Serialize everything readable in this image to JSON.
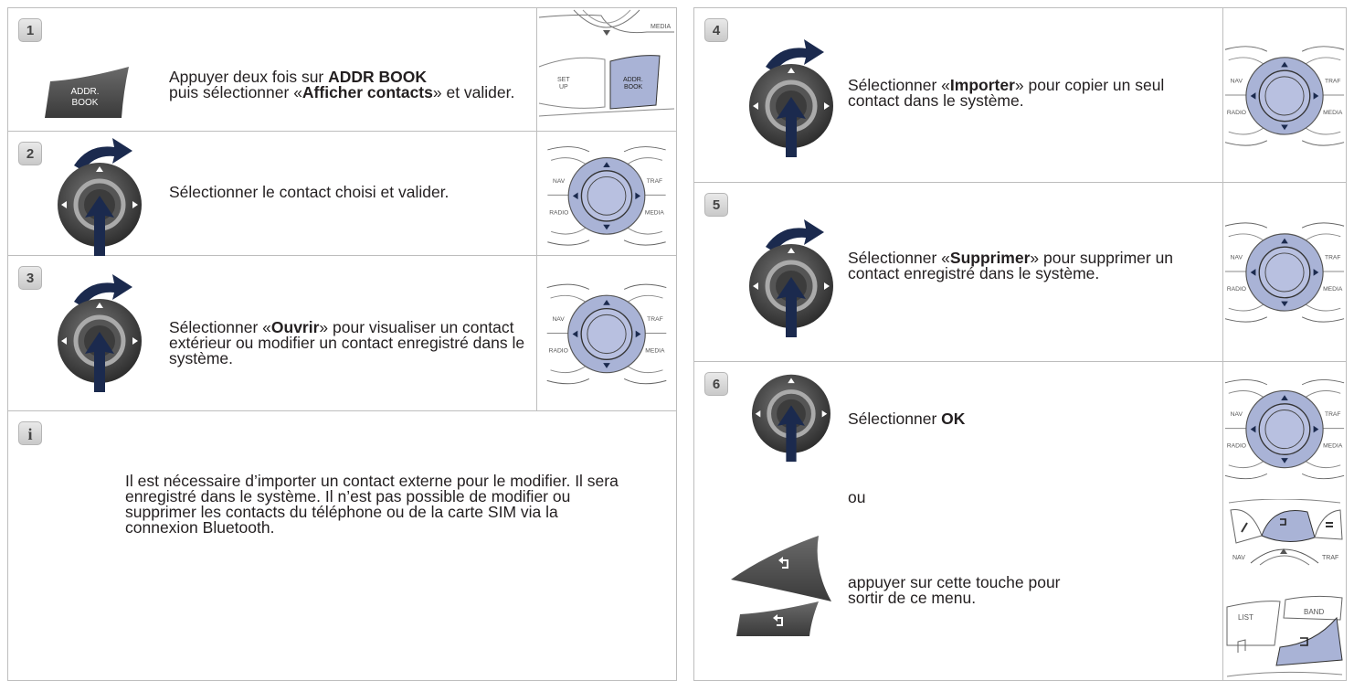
{
  "steps": [
    {
      "num": "1",
      "t1": "Appuyer deux fois sur ",
      "b1": "ADDR BOOK",
      "t2": "puis sélectionner «",
      "b2": "Afficher contacts",
      "t3": "» et valider.",
      "btn_l1": "ADDR.",
      "btn_l2": "BOOK"
    },
    {
      "num": "2",
      "text": "Sélectionner le contact choisi et valider."
    },
    {
      "num": "3",
      "t1": "Sélectionner «",
      "b1": "Ouvrir",
      "t2": "» pour visualiser un contact extérieur ou modifier un contact enregistré dans le système."
    },
    {
      "num": "4",
      "t1": "Sélectionner «",
      "b1": "Importer",
      "t2": "» pour copier un seul contact dans le système."
    },
    {
      "num": "5",
      "t1": "Sélectionner «",
      "b1": "Supprimer",
      "t2": "» pour supprimer un contact enregistré dans le système."
    },
    {
      "num": "6",
      "t1": "Sélectionner ",
      "b1": "OK",
      "or": "ou",
      "t2": "appuyer sur cette touche pour sortir de ce menu."
    }
  ],
  "info": {
    "icon": "i",
    "text": "Il est nécessaire d’importer un contact externe pour le modifier. Il sera enregistré dans le système. Il n’est pas possible de modifier ou supprimer les contacts du téléphone ou de la carte SIM via la connexion Bluetooth."
  },
  "labels": {
    "nav": "NAV",
    "traf": "TRAF",
    "radio": "RADIO",
    "media": "MEDIA",
    "set_up_1": "SET",
    "set_up_2": "UP",
    "addr_1": "ADDR.",
    "addr_2": "BOOK",
    "list": "LIST",
    "band": "BAND"
  },
  "colors": {
    "accent_blue": "#1b2a4e",
    "dial_highlight": "#a9b3d6",
    "button_dark": "#4a4a4a"
  }
}
